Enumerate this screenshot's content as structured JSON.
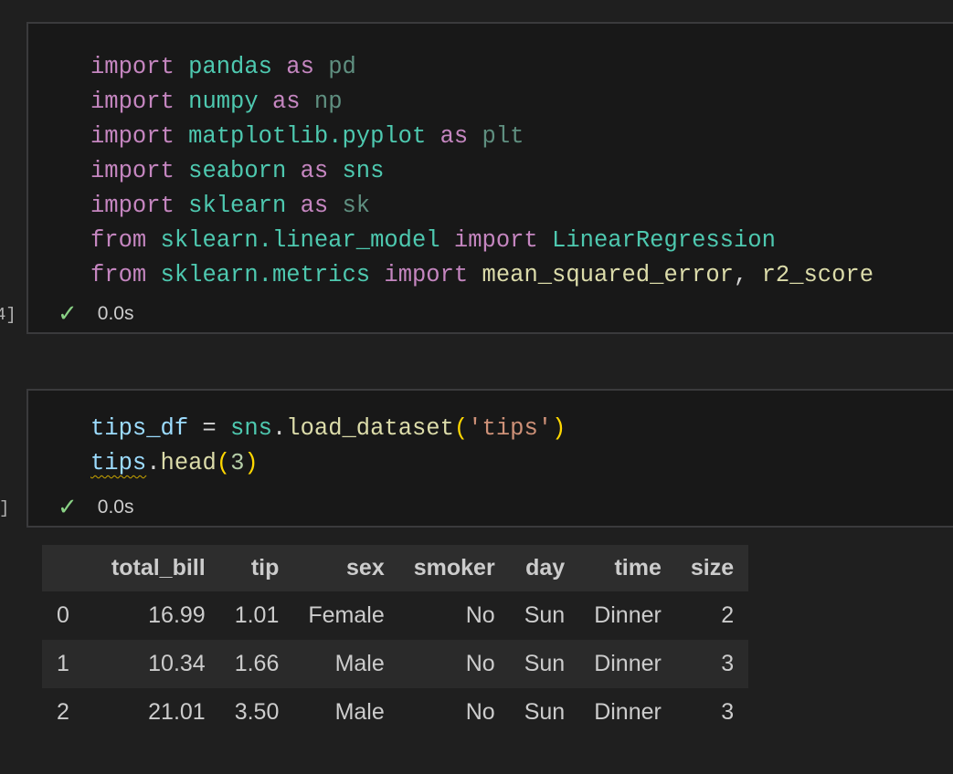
{
  "cells": [
    {
      "prompt": "4]",
      "code_lines": [
        [
          [
            "kw",
            "import"
          ],
          [
            "plain",
            " "
          ],
          [
            "mod",
            "pandas"
          ],
          [
            "plain",
            " "
          ],
          [
            "kw",
            "as"
          ],
          [
            "plain",
            " "
          ],
          [
            "dim",
            "pd"
          ]
        ],
        [
          [
            "kw",
            "import"
          ],
          [
            "plain",
            " "
          ],
          [
            "mod",
            "numpy"
          ],
          [
            "plain",
            " "
          ],
          [
            "kw",
            "as"
          ],
          [
            "plain",
            " "
          ],
          [
            "dim",
            "np"
          ]
        ],
        [
          [
            "kw",
            "import"
          ],
          [
            "plain",
            " "
          ],
          [
            "mod",
            "matplotlib.pyplot"
          ],
          [
            "plain",
            " "
          ],
          [
            "kw",
            "as"
          ],
          [
            "plain",
            " "
          ],
          [
            "dim",
            "plt"
          ]
        ],
        [
          [
            "kw",
            "import"
          ],
          [
            "plain",
            " "
          ],
          [
            "mod",
            "seaborn"
          ],
          [
            "plain",
            " "
          ],
          [
            "kw",
            "as"
          ],
          [
            "plain",
            " "
          ],
          [
            "mod",
            "sns"
          ]
        ],
        [
          [
            "kw",
            "import"
          ],
          [
            "plain",
            " "
          ],
          [
            "mod",
            "sklearn"
          ],
          [
            "plain",
            " "
          ],
          [
            "kw",
            "as"
          ],
          [
            "plain",
            " "
          ],
          [
            "dim",
            "sk"
          ]
        ],
        [
          [
            "kw",
            "from"
          ],
          [
            "plain",
            " "
          ],
          [
            "mod",
            "sklearn.linear_model"
          ],
          [
            "plain",
            " "
          ],
          [
            "kw",
            "import"
          ],
          [
            "plain",
            " "
          ],
          [
            "mod",
            "LinearRegression"
          ]
        ],
        [
          [
            "kw",
            "from"
          ],
          [
            "plain",
            " "
          ],
          [
            "mod",
            "sklearn.metrics"
          ],
          [
            "plain",
            " "
          ],
          [
            "kw",
            "import"
          ],
          [
            "plain",
            " "
          ],
          [
            "fn",
            "mean_squared_error"
          ],
          [
            "plain",
            ", "
          ],
          [
            "fn",
            "r2_score"
          ]
        ]
      ],
      "status_icon": "check-icon",
      "duration": "0.0s"
    },
    {
      "prompt": "]",
      "code_lines": [
        [
          [
            "var",
            "tips_df"
          ],
          [
            "plain",
            " = "
          ],
          [
            "mod",
            "sns"
          ],
          [
            "plain",
            "."
          ],
          [
            "fn",
            "load_dataset"
          ],
          [
            "par",
            "("
          ],
          [
            "str",
            "'tips'"
          ],
          [
            "par",
            ")"
          ]
        ],
        [
          [
            "var squig",
            "tips"
          ],
          [
            "plain",
            "."
          ],
          [
            "fn",
            "head"
          ],
          [
            "par",
            "("
          ],
          [
            "num",
            "3"
          ],
          [
            "par",
            ")"
          ]
        ]
      ],
      "status_icon": "check-icon",
      "duration": "0.0s"
    }
  ],
  "output_table": {
    "columns": [
      "",
      "total_bill",
      "tip",
      "sex",
      "smoker",
      "day",
      "time",
      "size"
    ],
    "rows": [
      [
        "0",
        "16.99",
        "1.01",
        "Female",
        "No",
        "Sun",
        "Dinner",
        "2"
      ],
      [
        "1",
        "10.34",
        "1.66",
        "Male",
        "No",
        "Sun",
        "Dinner",
        "3"
      ],
      [
        "2",
        "21.01",
        "3.50",
        "Male",
        "No",
        "Sun",
        "Dinner",
        "3"
      ]
    ]
  },
  "colors": {
    "keyword": "#c586c0",
    "module": "#4ec9b0",
    "variable": "#9cdcfe",
    "function": "#dcdcaa",
    "string": "#ce9178",
    "success": "#89d185"
  }
}
